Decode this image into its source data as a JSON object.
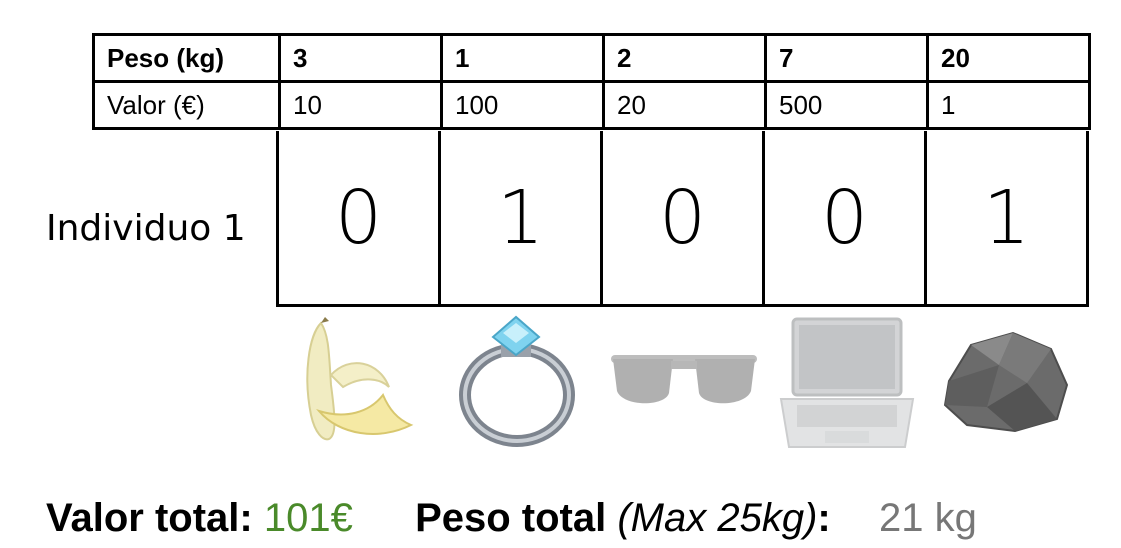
{
  "table": {
    "row_weight": {
      "label": "Peso (kg)",
      "values": [
        "3",
        "1",
        "2",
        "7",
        "20"
      ]
    },
    "row_value": {
      "label": "Valor (€)",
      "values": [
        "10",
        "100",
        "20",
        "500",
        "1"
      ]
    }
  },
  "individual": {
    "label": "Individuo 1",
    "genes": [
      "0",
      "1",
      "0",
      "0",
      "1"
    ]
  },
  "items": [
    {
      "icon": "banana-icon",
      "selected": false
    },
    {
      "icon": "ring-icon",
      "selected": true
    },
    {
      "icon": "sunglasses-icon",
      "selected": false
    },
    {
      "icon": "laptop-icon",
      "selected": false
    },
    {
      "icon": "rock-icon",
      "selected": true
    }
  ],
  "footer": {
    "value_label": "Valor total:",
    "value": "101€",
    "weight_label": "Peso total",
    "weight_max": "(Max 25kg)",
    "weight_colon": ":",
    "weight": "21 kg"
  },
  "colors": {
    "value_green": "#4a8a2a",
    "weight_gray": "#777777"
  }
}
